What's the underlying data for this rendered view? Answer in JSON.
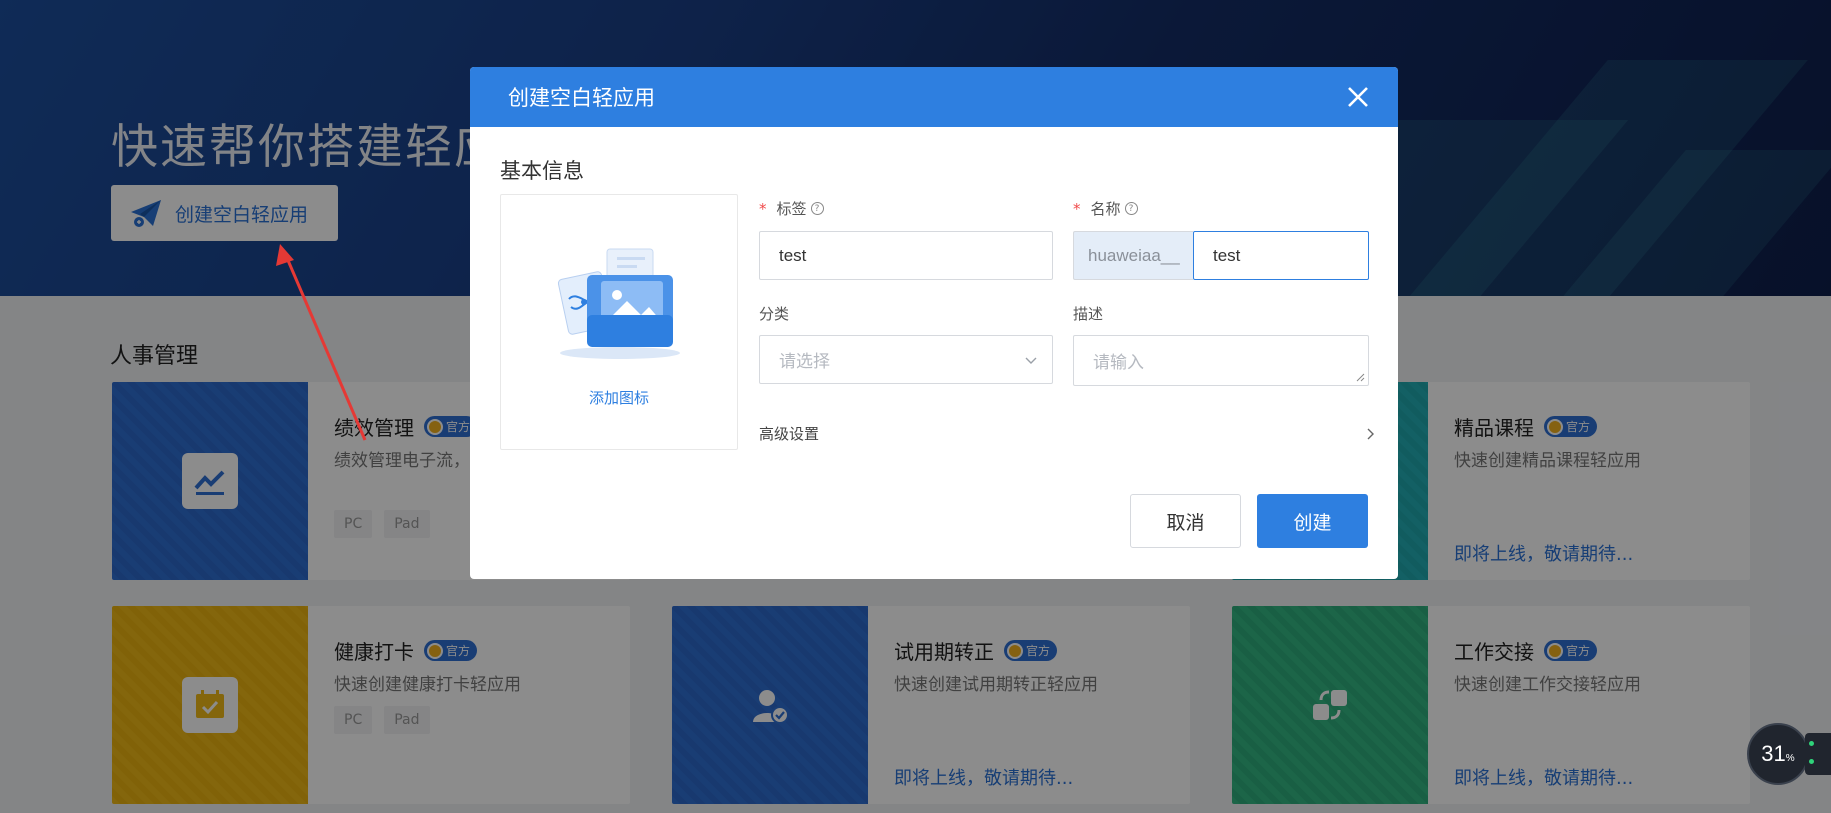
{
  "hero": {
    "title": "快速帮你搭建轻应",
    "create_button_label": "创建空白轻应用"
  },
  "section": {
    "title": "人事管理"
  },
  "cards": [
    {
      "title": "绩效管理",
      "badge": "官方",
      "desc": "绩效管理电子流，完成员工绩效管理",
      "tags": [
        "PC",
        "Pad"
      ],
      "color": "#2f6fd3",
      "icon": "chart-trend-icon"
    },
    {
      "title": "精品课程",
      "badge": "官方",
      "desc": "快速创建精品课程轻应用",
      "soon": "即将上线，敬请期待...",
      "color": "#23b0b7",
      "icon": "course-icon"
    },
    {
      "title": "健康打卡",
      "badge": "官方",
      "desc": "快速创建健康打卡轻应用",
      "tags": [
        "PC",
        "Pad"
      ],
      "color": "#f1ba16",
      "icon": "calendar-check-icon"
    },
    {
      "title": "试用期转正",
      "badge": "官方",
      "desc": "快速创建试用期转正轻应用",
      "soon": "即将上线，敬请期待...",
      "color": "#2f6fd3",
      "icon": "user-check-icon"
    },
    {
      "title": "工作交接",
      "badge": "官方",
      "desc": "快速创建工作交接轻应用",
      "soon": "即将上线，敬请期待...",
      "color": "#33b883",
      "icon": "handover-icon"
    }
  ],
  "dialog": {
    "title": "创建空白轻应用",
    "section_title": "基本信息",
    "add_icon_label": "添加图标",
    "fields": {
      "tag": {
        "label": "标签",
        "value": "test"
      },
      "name": {
        "label": "名称",
        "prefix": "huaweiaa__",
        "value": "test"
      },
      "category": {
        "label": "分类",
        "placeholder": "请选择"
      },
      "description": {
        "label": "描述",
        "placeholder": "请输入"
      }
    },
    "advanced_label": "高级设置",
    "cancel_label": "取消",
    "create_label": "创建"
  },
  "monitor": {
    "value": "31",
    "unit": "%"
  },
  "colors": {
    "primary": "#2e7fe0",
    "required": "#f04a4a"
  }
}
